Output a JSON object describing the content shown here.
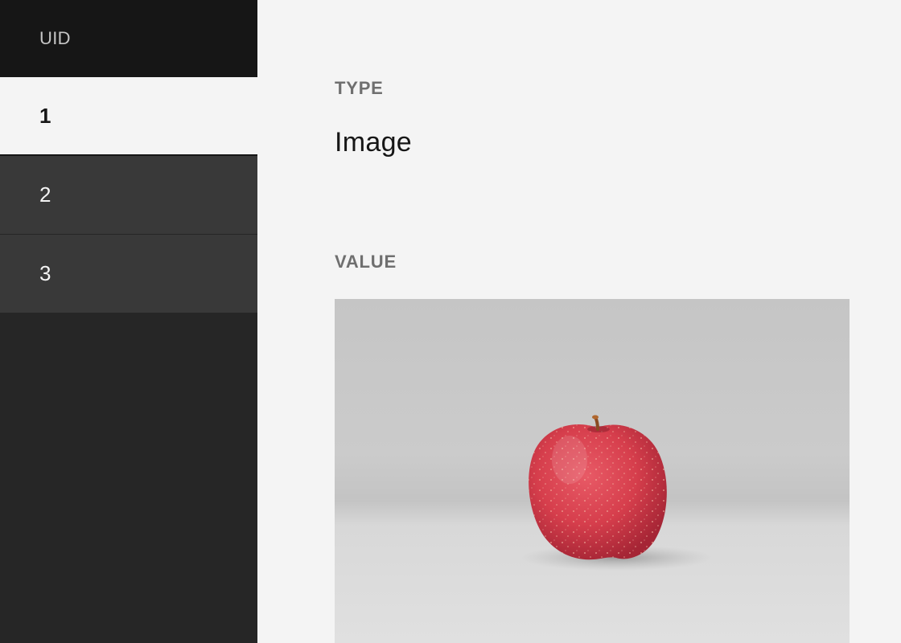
{
  "sidebar": {
    "header": "UID",
    "items": [
      {
        "label": "1",
        "active": true
      },
      {
        "label": "2",
        "active": false
      },
      {
        "label": "3",
        "active": false
      }
    ]
  },
  "main": {
    "type_label": "TYPE",
    "type_value": "Image",
    "value_label": "VALUE",
    "value_image": "apple-photo"
  }
}
